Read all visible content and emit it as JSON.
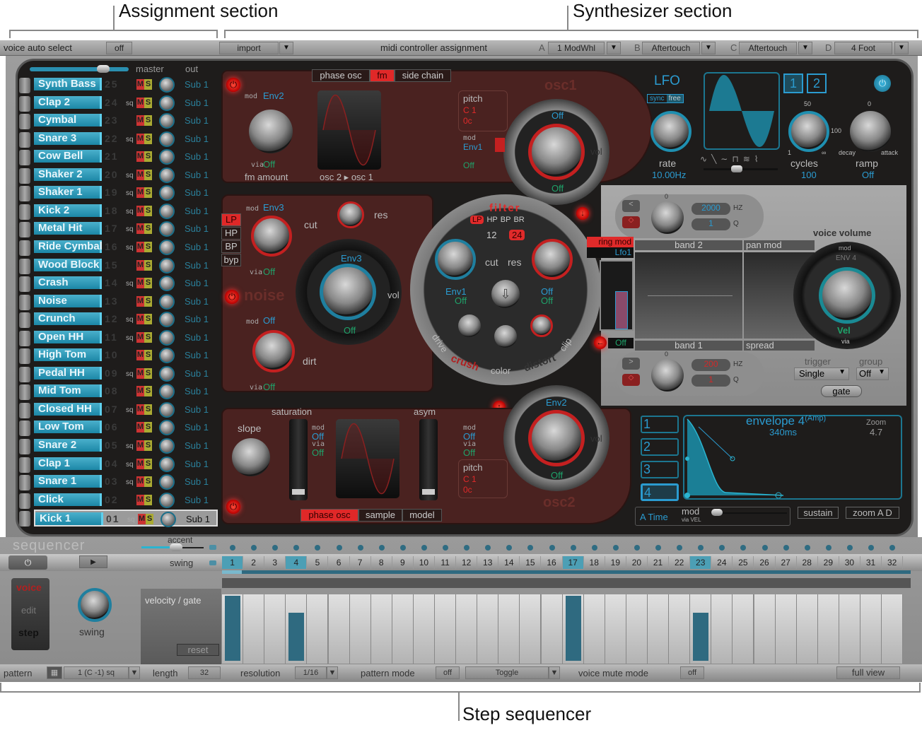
{
  "callouts": {
    "assignment": "Assignment section",
    "synthesizer": "Synthesizer section",
    "sequencer": "Step sequencer"
  },
  "topbar": {
    "voice_auto_select_label": "voice auto select",
    "voice_auto_select_value": "off",
    "import_label": "import",
    "midi_assign_label": "midi controller assignment",
    "controllers": [
      {
        "letter": "A",
        "value": "1 ModWhl"
      },
      {
        "letter": "B",
        "value": "Aftertouch"
      },
      {
        "letter": "C",
        "value": "Aftertouch"
      },
      {
        "letter": "D",
        "value": "4 Foot"
      }
    ]
  },
  "voices": {
    "master_label": "master",
    "out_label": "out",
    "items": [
      {
        "name": "Synth Bass",
        "num": "25",
        "sq": "",
        "out": "Sub 1"
      },
      {
        "name": "Clap 2",
        "num": "24",
        "sq": "sq",
        "out": "Sub 1"
      },
      {
        "name": "Cymbal",
        "num": "23",
        "sq": "",
        "out": "Sub 1"
      },
      {
        "name": "Snare 3",
        "num": "22",
        "sq": "sq",
        "out": "Sub 1"
      },
      {
        "name": "Cow Bell",
        "num": "21",
        "sq": "",
        "out": "Sub 1"
      },
      {
        "name": "Shaker 2",
        "num": "20",
        "sq": "sq",
        "out": "Sub 1"
      },
      {
        "name": "Shaker 1",
        "num": "19",
        "sq": "sq",
        "out": "Sub 1"
      },
      {
        "name": "Kick 2",
        "num": "18",
        "sq": "sq",
        "out": "Sub 1"
      },
      {
        "name": "Metal Hit",
        "num": "17",
        "sq": "sq",
        "out": "Sub 1"
      },
      {
        "name": "Ride Cymbal",
        "num": "16",
        "sq": "sq",
        "out": "Sub 1"
      },
      {
        "name": "Wood Block",
        "num": "15",
        "sq": "",
        "out": "Sub 1"
      },
      {
        "name": "Crash",
        "num": "14",
        "sq": "sq",
        "out": "Sub 1"
      },
      {
        "name": "Noise",
        "num": "13",
        "sq": "",
        "out": "Sub 1"
      },
      {
        "name": "Crunch",
        "num": "12",
        "sq": "sq",
        "out": "Sub 1"
      },
      {
        "name": "Open HH",
        "num": "11",
        "sq": "sq",
        "out": "Sub 1"
      },
      {
        "name": "High Tom",
        "num": "10",
        "sq": "",
        "out": "Sub 1"
      },
      {
        "name": "Pedal HH",
        "num": "09",
        "sq": "sq",
        "out": "Sub 1"
      },
      {
        "name": "Mid Tom",
        "num": "08",
        "sq": "",
        "out": "Sub 1"
      },
      {
        "name": "Closed HH",
        "num": "07",
        "sq": "sq",
        "out": "Sub 1"
      },
      {
        "name": "Low Tom",
        "num": "06",
        "sq": "",
        "out": "Sub 1"
      },
      {
        "name": "Snare 2",
        "num": "05",
        "sq": "sq",
        "out": "Sub 1"
      },
      {
        "name": "Clap 1",
        "num": "04",
        "sq": "sq",
        "out": "Sub 1"
      },
      {
        "name": "Snare 1",
        "num": "03",
        "sq": "sq",
        "out": "Sub 1"
      },
      {
        "name": "Click",
        "num": "02",
        "sq": "",
        "out": "Sub 1"
      },
      {
        "name": "Kick 1",
        "num": "01",
        "sq": "sq",
        "out": "Sub 1",
        "selected": true
      }
    ],
    "mute_label": "M",
    "solo_label": "S"
  },
  "osc1": {
    "title": "osc1",
    "modes": [
      "phase osc",
      "fm",
      "side chain"
    ],
    "active_mode": "fm",
    "fm_mod_label": "mod",
    "fm_mod": "Env2",
    "fm_via_label": "via",
    "fm_via": "Off",
    "fm_amount_label": "fm amount",
    "wave_label": "osc 2 ▸ osc 1",
    "pitch_label": "pitch",
    "pitch_note": "C 1",
    "pitch_cents": "0c",
    "pitch_mod": "Env1",
    "pitch_via": "Off",
    "vol_mod": "Off",
    "vol_via": "Off",
    "vol_label": "vol"
  },
  "noise": {
    "title": "noise",
    "filter_types": [
      "LP",
      "HP",
      "BP",
      "byp"
    ],
    "active_filter": "LP",
    "cut_mod": "Env3",
    "cut_via": "Off",
    "cut_label": "cut",
    "res_label": "res",
    "dirt_mod": "Off",
    "dirt_via": "Off",
    "dirt_label": "dirt",
    "vol_mod": "Env3",
    "vol_via": "Off",
    "vol_label": "vol"
  },
  "filter": {
    "title": "filter",
    "types": [
      "LP",
      "HP",
      "BP",
      "BR"
    ],
    "active_type": "LP",
    "slopes": [
      "12",
      "24"
    ],
    "active_slope": "24",
    "cut_label": "cut",
    "res_label": "res",
    "cut_mod": "Env1",
    "cut_via": "Off",
    "res_mod": "Off",
    "res_via": "Off",
    "drive_label": "drive",
    "color_label": "color",
    "clip_label": "clip",
    "crush_label": "crush",
    "distort_label": "distort"
  },
  "ringmod": {
    "label": "ring mod",
    "source": "Lfo1",
    "via": "Off"
  },
  "eq": {
    "band2_label": "band 2",
    "band2_hz": "2000",
    "band2_q": "1",
    "band1_label": "band 1",
    "band1_hz": "200",
    "band1_q": "1",
    "hz_unit": "HZ",
    "q_unit": "Q",
    "zero": "0",
    "minus": "-",
    "plus": "+",
    "pan_mod_label": "pan mod",
    "spread_label": "spread"
  },
  "lfo": {
    "title": "LFO",
    "sync_label": "sync",
    "free_label": "free",
    "rate_label": "rate",
    "rate_value": "10.00Hz",
    "tabs": [
      "1",
      "2"
    ],
    "active_tab": "1",
    "cycles_label": "cycles",
    "cycles_value": "100",
    "cycles_ticks": [
      "50",
      "1",
      "100",
      "∞"
    ],
    "ramp_label": "ramp",
    "ramp_value": "Off",
    "ramp_ticks": [
      "0",
      "decay",
      "attack"
    ],
    "waveforms": [
      "∿",
      "╲",
      "∼",
      "⊓",
      "≋",
      "⌇"
    ],
    "waveform_position": 0.45
  },
  "voice_volume": {
    "label": "voice volume",
    "mod_label": "mod",
    "mod": "ENV 4",
    "via": "Vel",
    "via_label": "via",
    "trigger_label": "trigger",
    "trigger_value": "Single",
    "group_label": "group",
    "group_value": "Off",
    "gate_label": "gate"
  },
  "osc2": {
    "title": "osc2",
    "modes": [
      "phase osc",
      "sample",
      "model"
    ],
    "active_mode": "phase osc",
    "slope_label": "slope",
    "saturation_label": "saturation",
    "asym_label": "asym",
    "sat_mod": "Off",
    "sat_via": "Off",
    "pitch_mod": "Off",
    "pitch_via": "Off",
    "pitch_label": "pitch",
    "pitch_note": "C 1",
    "pitch_cents": "0c",
    "vol_mod": "Env2",
    "vol_via": "Off",
    "vol_label": "vol"
  },
  "envelope": {
    "title": "envelope 4",
    "subtitle": "(Amp)",
    "time": "340ms",
    "zoom_label": "Zoom",
    "zoom_value": "4.7",
    "selectors": [
      "1",
      "2",
      "3",
      "4"
    ],
    "active": "4",
    "a_time_label": "A Time",
    "mod_label": "mod",
    "via_label": "via VEL",
    "sustain_label": "sustain",
    "zoom_ad_label": "zoom A D"
  },
  "sequencer": {
    "title": "sequencer",
    "accent_label": "accent",
    "swing_label": "swing",
    "mode_voice": "voice",
    "mode_edit": "edit",
    "mode_step": "step",
    "swing_knob_label": "swing",
    "velocity_label": "velocity / gate",
    "reset_label": "reset",
    "steps": [
      "1",
      "2",
      "3",
      "4",
      "5",
      "6",
      "7",
      "8",
      "9",
      "10",
      "11",
      "12",
      "13",
      "14",
      "15",
      "16",
      "17",
      "18",
      "19",
      "20",
      "21",
      "22",
      "23",
      "24",
      "25",
      "26",
      "27",
      "28",
      "29",
      "30",
      "31",
      "32"
    ],
    "active_steps": [
      1,
      4,
      17,
      23
    ],
    "velocities": {
      "1": 1.0,
      "4": 0.74,
      "17": 1.0,
      "23": 0.74
    },
    "bottom": {
      "pattern_label": "pattern",
      "pattern_value": "1 (C -1) sq",
      "length_label": "length",
      "length_value": "32",
      "resolution_label": "resolution",
      "resolution_value": "1/16",
      "pattern_mode_label": "pattern mode",
      "pattern_mode_value": "off",
      "toggle_value": "Toggle",
      "voice_mute_label": "voice mute mode",
      "voice_mute_value": "off",
      "full_view_label": "full view"
    }
  }
}
